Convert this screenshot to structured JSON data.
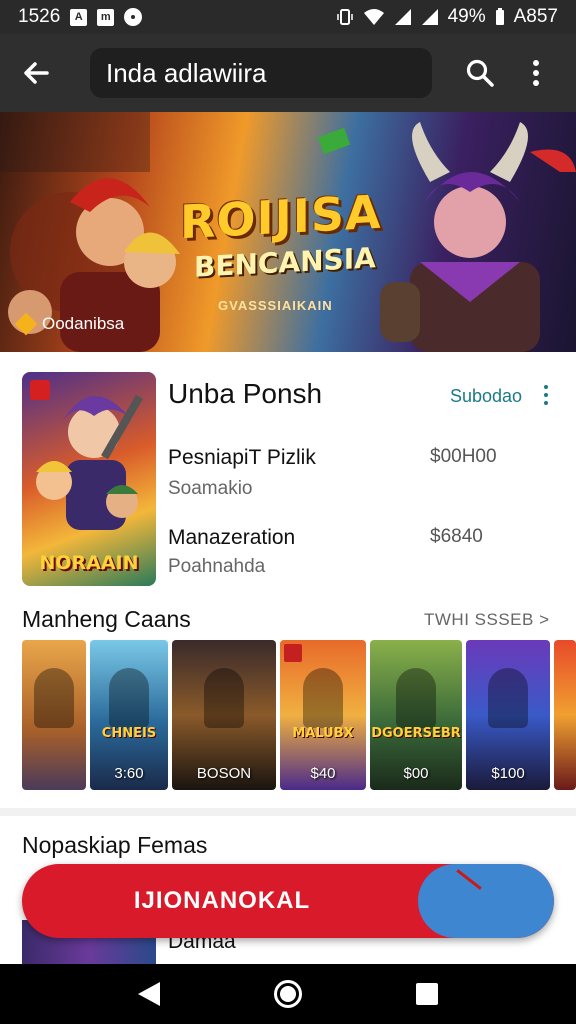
{
  "status_bar": {
    "time": "1526",
    "battery": "49%",
    "extra": "A857"
  },
  "app_bar": {
    "search_text": "Inda adlawiira",
    "icons": [
      "back-arrow-icon",
      "search-icon",
      "more-vert-icon"
    ]
  },
  "hero": {
    "title": "ROIJISA",
    "subtitle": "BENCANSIA",
    "small_text": "GVASSSIAIKAIN",
    "badge": "Oodanibsa"
  },
  "featured": {
    "cover_title": "NORAAIN",
    "title": "Unba Ponsh",
    "action": "Subodao",
    "rows": [
      {
        "name": "PesniapiT Pizlik",
        "sub": "Soamakio",
        "price": "$00H00"
      },
      {
        "name": "Manazeration",
        "sub": "Poahnahda",
        "price": "$6840"
      }
    ]
  },
  "section": {
    "title": "Manheng Caans",
    "link": "TWHI SSSEB >",
    "tiles": [
      {
        "label": "",
        "caption": ""
      },
      {
        "label": "3:60",
        "caption": "CHNEIS"
      },
      {
        "label": "BOSON",
        "caption": ""
      },
      {
        "label": "$40",
        "caption": "MALUBX"
      },
      {
        "label": "$00",
        "caption": "DGOERSEBR"
      },
      {
        "label": "$100",
        "caption": ""
      },
      {
        "label": "",
        "caption": ""
      }
    ]
  },
  "section2": {
    "title": "Nopaskiap Femas",
    "peek_text": "Damaa"
  },
  "cta": {
    "label": "IJIONANOKAL"
  },
  "colors": {
    "accent_red": "#d91a2a",
    "accent_blue": "#3f86d0",
    "link_teal": "#1a7a8a"
  }
}
